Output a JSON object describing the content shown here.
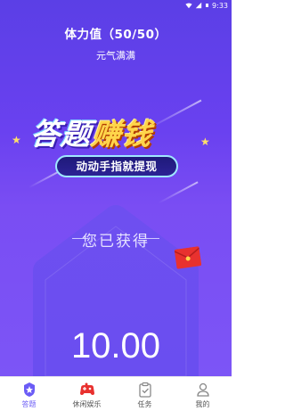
{
  "status_bar": {
    "time": "9:33"
  },
  "header": {
    "stamina_text": "体力值（50/50）",
    "stamina_sub": "元气满满"
  },
  "banner": {
    "title_part1": "答题",
    "title_part2": "赚钱",
    "subtitle": "动动手指就提现"
  },
  "earnings": {
    "label": "您已获得",
    "value": "10.00"
  },
  "tabs": [
    {
      "label": "答题",
      "icon": "quiz-icon",
      "active": true
    },
    {
      "label": "休闲娱乐",
      "icon": "gamepad-icon",
      "active": false
    },
    {
      "label": "任务",
      "icon": "clipboard-icon",
      "active": false
    },
    {
      "label": "我的",
      "icon": "user-icon",
      "active": false
    }
  ],
  "colors": {
    "gradient_top": "#5b3fe6",
    "gradient_bottom": "#7c55f6",
    "accent_gold": "#ffd54a",
    "tab_active": "#6b5cf6",
    "envelope_red": "#e8312f"
  }
}
